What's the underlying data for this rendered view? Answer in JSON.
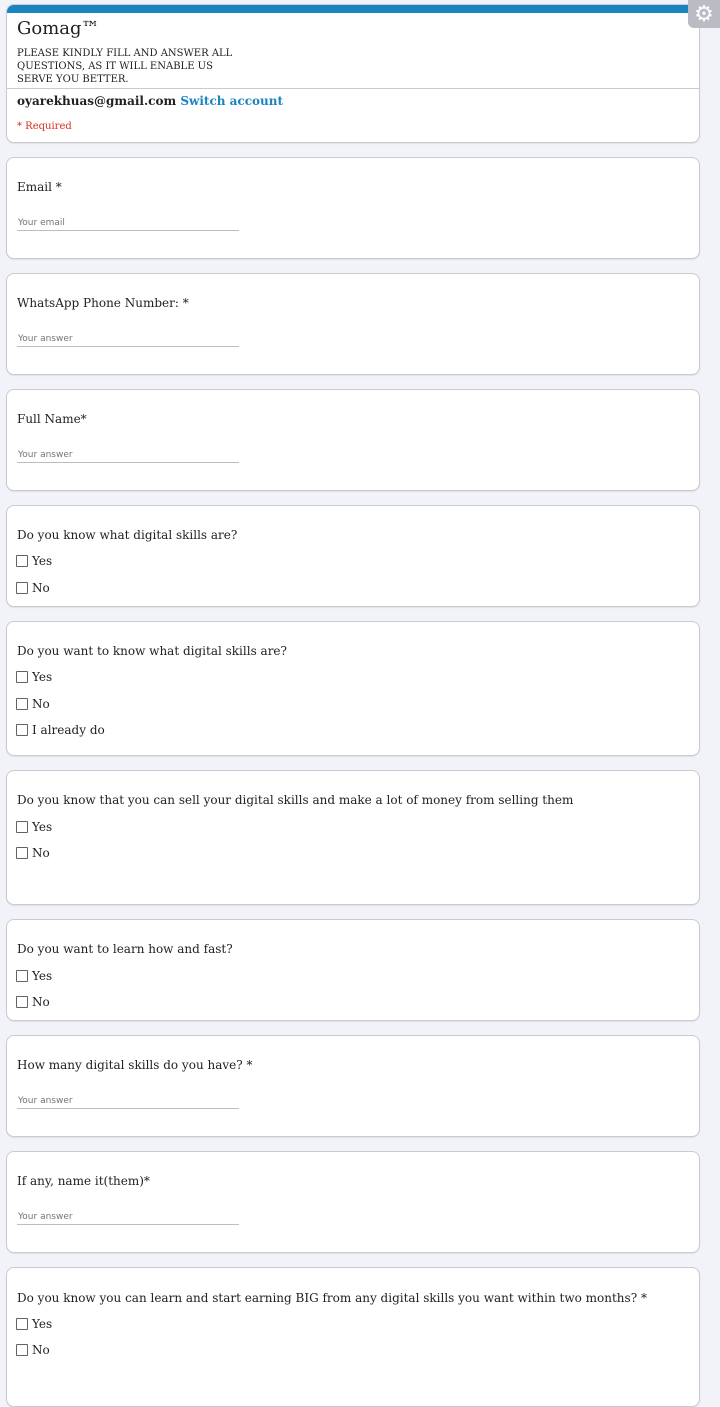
{
  "form": {
    "title": "Gomag™",
    "description": "PLEASE KINDLY FILL AND ANSWER ALL QUESTIONS, AS IT WILL ENABLE US SERVE YOU BETTER.",
    "account_email": "oyarekhuas@gmail.com",
    "switch_account": "Switch account",
    "required_note": "* Required",
    "settings_icon": "gear-icon"
  },
  "questions": {
    "email": {
      "label": "Email *",
      "placeholder": "Your email"
    },
    "whatsapp": {
      "label": "WhatsApp Phone Number: *",
      "placeholder": "Your answer"
    },
    "full_name": {
      "label": "Full Name*",
      "placeholder": "Your answer"
    },
    "know_digital": {
      "label": "Do you know what digital skills are?",
      "options": [
        "Yes",
        "No"
      ]
    },
    "want_know": {
      "label": "Do you want to know what digital skills are?",
      "options": [
        "Yes",
        "No",
        "I already do"
      ]
    },
    "sell_skills": {
      "label": "Do you know that you can sell your digital skills and make a lot of money from selling them",
      "options": [
        "Yes",
        "No"
      ]
    },
    "learn_fast": {
      "label": "Do you want to learn how and fast?",
      "options": [
        "Yes",
        "No"
      ]
    },
    "how_many": {
      "label": "How many digital skills do you have? *",
      "placeholder": "Your answer"
    },
    "name_them": {
      "label": "If any, name it(them)*",
      "placeholder": "Your answer"
    },
    "earn_big": {
      "label": "Do you know you can learn and start earning BIG from any digital skills you want within two months? *",
      "options": [
        "Yes",
        "No"
      ]
    }
  }
}
